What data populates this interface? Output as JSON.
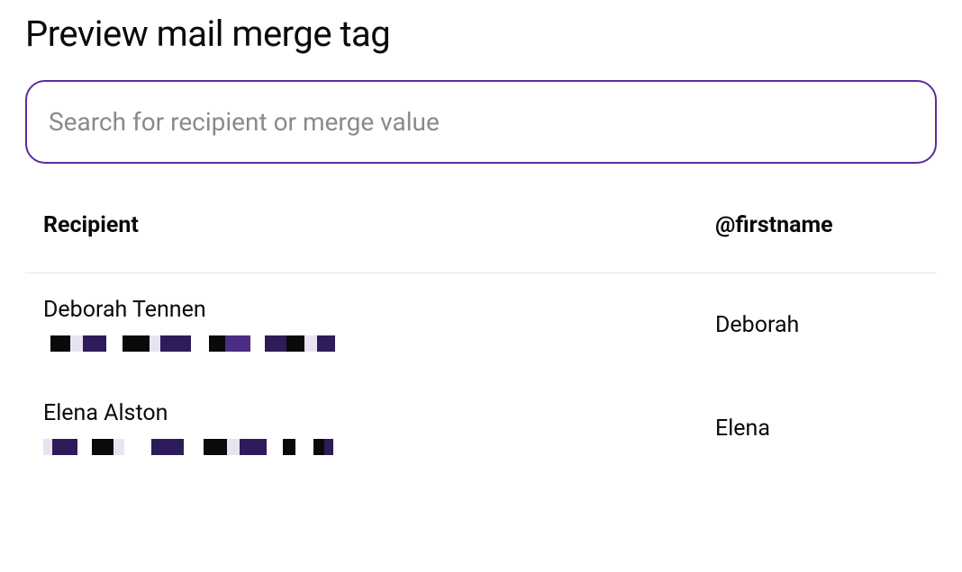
{
  "page_title": "Preview mail merge tag",
  "search": {
    "placeholder": "Search for recipient or merge value",
    "value": ""
  },
  "table": {
    "headers": {
      "recipient": "Recipient",
      "firstname": "@firstname"
    },
    "rows": [
      {
        "recipient_name": "Deborah Tennen",
        "firstname": "Deborah"
      },
      {
        "recipient_name": "Elena Alston",
        "firstname": "Elena"
      }
    ]
  }
}
